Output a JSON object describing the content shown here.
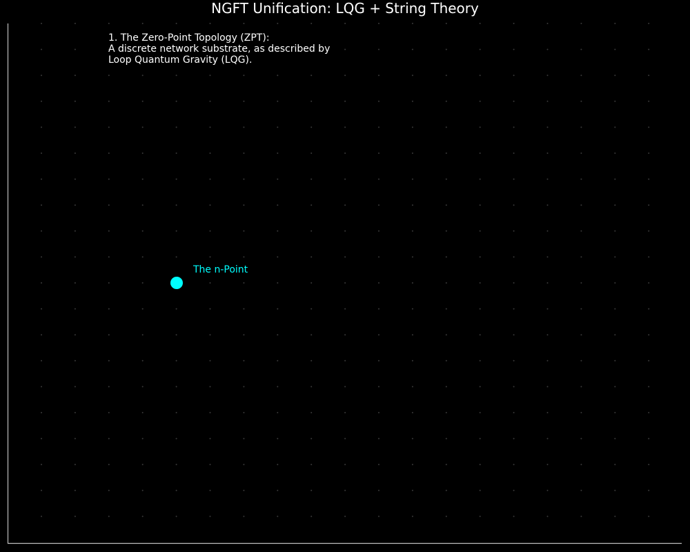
{
  "title": "NGFT Unification: LQG + String Theory",
  "annotation": {
    "heading": "1. The Zero-Point Topology (ZPT):",
    "line1": "A discrete network substrate, as described by",
    "line2": "Loop Quantum Gravity (LQG)."
  },
  "point": {
    "label": "The n-Point",
    "color": "#00ffff"
  },
  "colors": {
    "background": "#000000",
    "text": "#ffffff",
    "axis": "#bfbfbf",
    "grid_dot": "#3a3a3a"
  }
}
